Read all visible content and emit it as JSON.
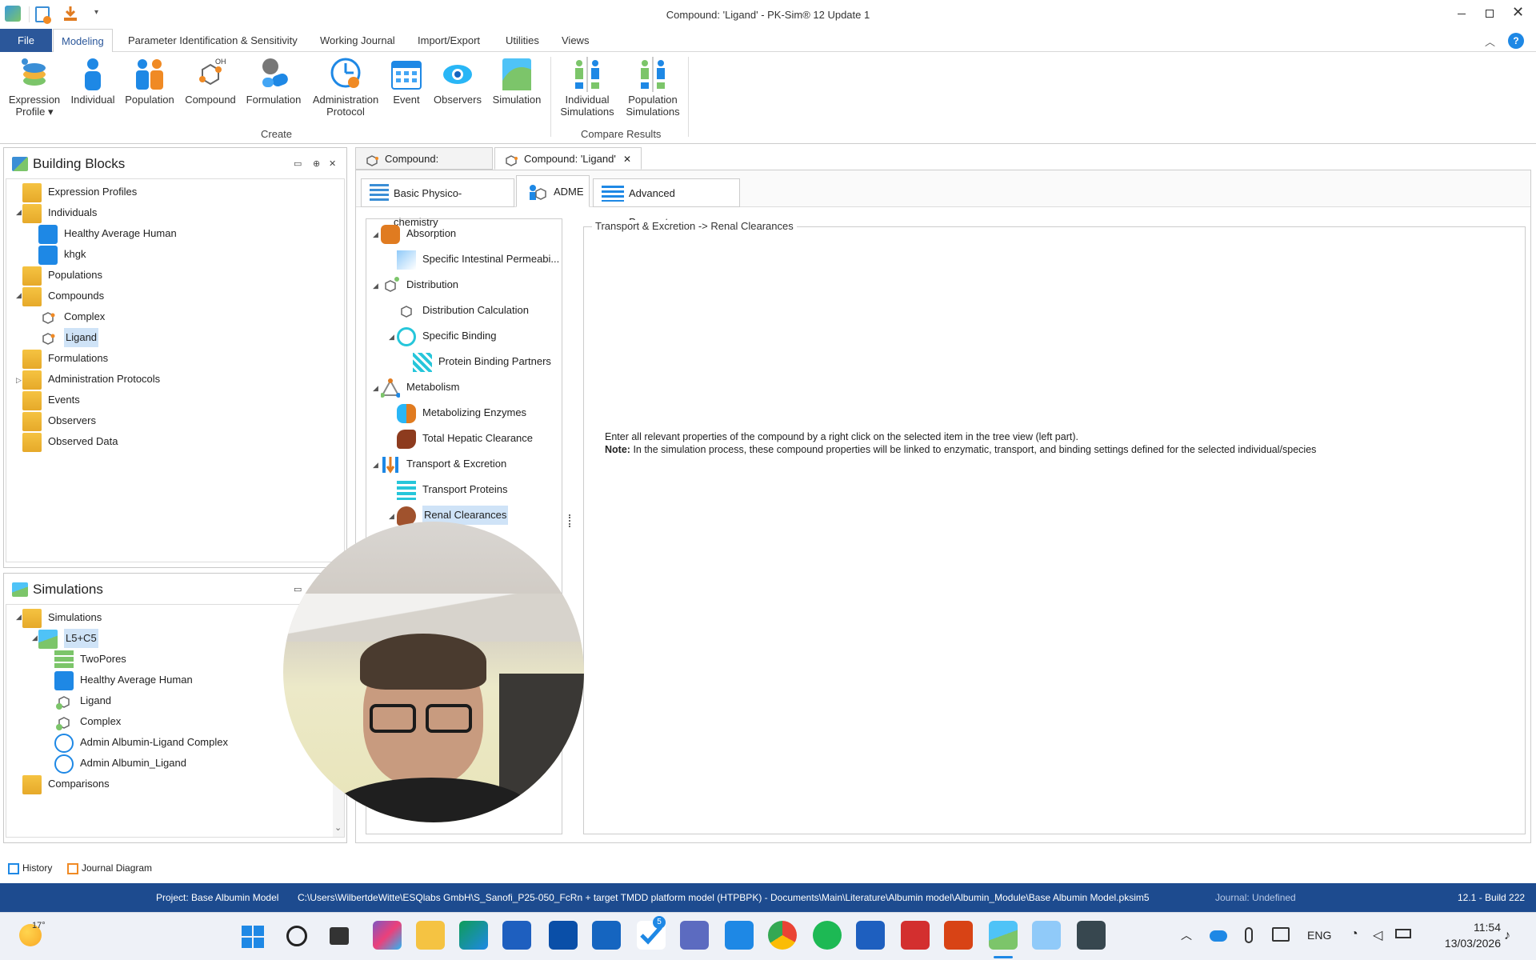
{
  "window": {
    "title": "Compound: 'Ligand' - PK-Sim® 12 Update 1"
  },
  "menu": {
    "items": [
      "File",
      "Modeling",
      "Parameter Identification & Sensitivity",
      "Working Journal",
      "Import/Export",
      "Utilities",
      "Views"
    ]
  },
  "ribbon": {
    "create_buttons": [
      {
        "line1": "Expression",
        "line2": "Profile ▾"
      },
      {
        "line1": "Individual",
        "line2": ""
      },
      {
        "line1": "Population",
        "line2": ""
      },
      {
        "line1": "Compound",
        "line2": ""
      },
      {
        "line1": "Formulation",
        "line2": ""
      },
      {
        "line1": "Administration",
        "line2": "Protocol"
      },
      {
        "line1": "Event",
        "line2": ""
      },
      {
        "line1": "Observers",
        "line2": ""
      },
      {
        "line1": "Simulation",
        "line2": ""
      }
    ],
    "compare_buttons": [
      {
        "line1": "Individual",
        "line2": "Simulations"
      },
      {
        "line1": "Population",
        "line2": "Simulations"
      }
    ],
    "group_create": "Create",
    "group_compare": "Compare Results"
  },
  "building_blocks": {
    "title": "Building Blocks",
    "items": [
      "Expression Profiles",
      "Individuals",
      "Healthy Average Human",
      "khgk",
      "Populations",
      "Compounds",
      "Complex",
      "Ligand",
      "Formulations",
      "Administration Protocols",
      "Events",
      "Observers",
      "Observed Data"
    ]
  },
  "simulations": {
    "title": "Simulations",
    "items": [
      "Simulations",
      "L5+C5",
      "TwoPores",
      "Healthy Average Human",
      "Ligand",
      "Complex",
      "Admin Albumin-Ligand Complex",
      "Admin Albumin_Ligand",
      "Comparisons"
    ]
  },
  "doc_tabs": [
    "Compound: 'Complex'",
    "Compound: 'Ligand'"
  ],
  "sub_tabs": [
    "Basic Physico-chemistry",
    "ADME",
    "Advanced Parameters"
  ],
  "adme_tree": [
    "Absorption",
    "Specific Intestinal Permeabi...",
    "Distribution",
    "Distribution Calculation",
    "Specific Binding",
    "Protein Binding Partners",
    "Metabolism",
    "Metabolizing Enzymes",
    "Total Hepatic Clearance",
    "Transport & Excretion",
    "Transport Proteins",
    "Renal Clearances"
  ],
  "detail": {
    "group_title": "Transport & Excretion -> Renal Clearances",
    "line1": "Enter all relevant properties of the compound by a right click on the selected item in the tree view (left part).",
    "note_label": "Note:",
    "line2": "In the simulation process, these compound properties will be linked to enzymatic, transport, and binding settings defined for the selected individual/species"
  },
  "bottom_tabs": [
    "History",
    "Journal Diagram"
  ],
  "status": {
    "project": "Project: Base Albumin Model",
    "path": "C:\\Users\\WilbertdeWitte\\ESQlabs GmbH\\S_Sanofi_P25-050_FcRn + target TMDD platform model (HTPBPK) - Documents\\Main\\Literature\\Albumin model\\Albumin_Module\\Base Albumin Model.pksim5",
    "journal": "Journal: Undefined",
    "build": "12.1 - Build 222"
  },
  "taskbar": {
    "temp": "17°",
    "lang": "ENG",
    "time": "11:54",
    "date": "13/03/2026",
    "badge_count": "5"
  },
  "colors": {
    "accent": "#2b579a",
    "status_bar": "#1d4b8f",
    "selection": "#cfe3f7",
    "folder": "#f0b93a"
  }
}
